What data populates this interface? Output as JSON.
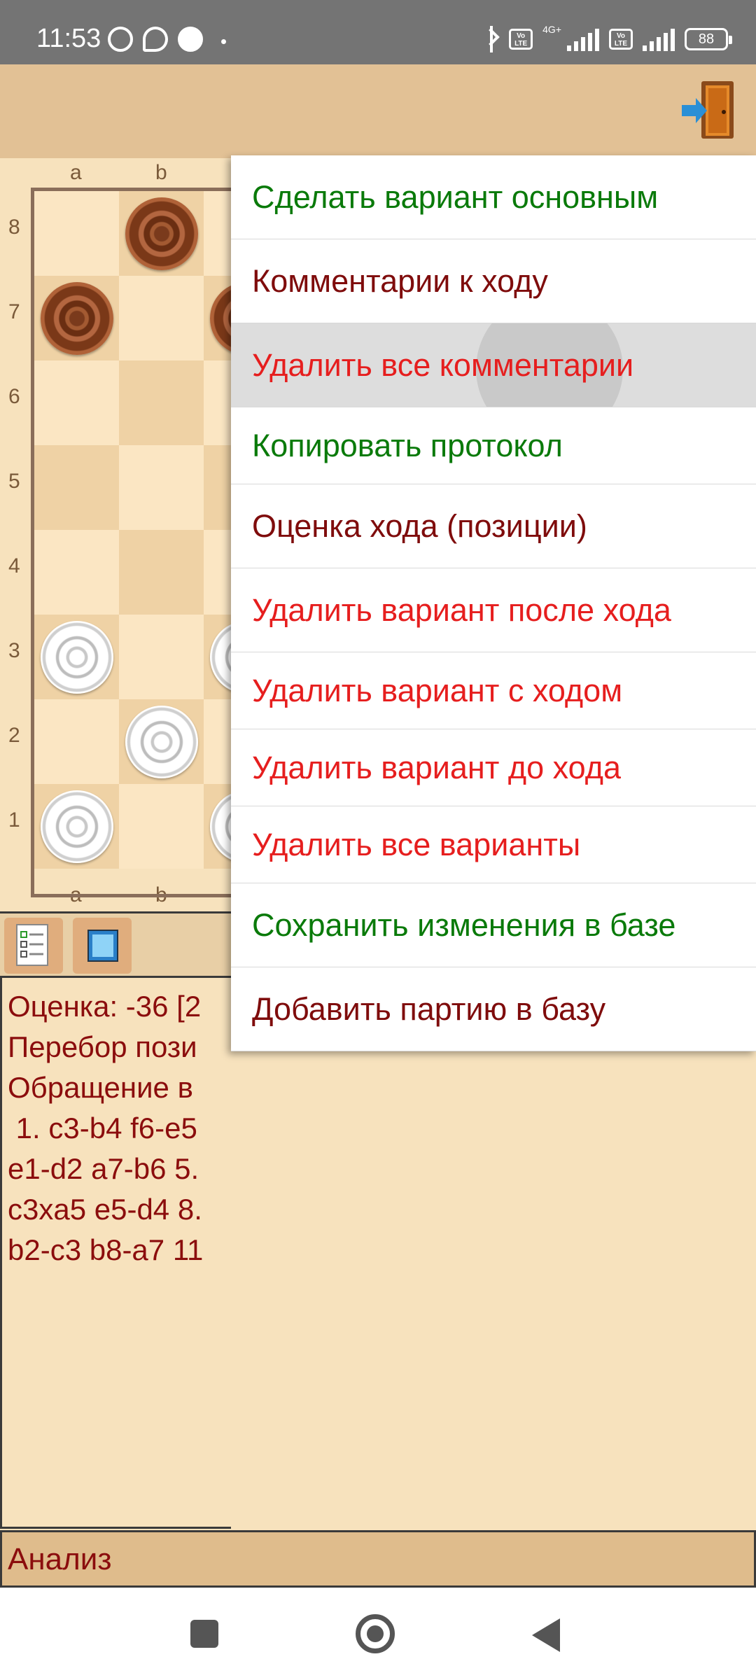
{
  "status_bar": {
    "time": "11:53",
    "network": "4G+",
    "volte": "Vo LTE",
    "battery": "88",
    "icons": [
      "viber-icon",
      "at-icon",
      "call-icon",
      "bluetooth-icon",
      "signal-icon",
      "battery-icon"
    ]
  },
  "toolbar": {
    "exit_icon": "exit-door-icon"
  },
  "board": {
    "files": [
      "a",
      "b"
    ],
    "ranks": [
      "8",
      "7",
      "6",
      "5",
      "4",
      "3",
      "2",
      "1"
    ],
    "pieces": [
      {
        "square": "b8",
        "color": "black"
      },
      {
        "square": "a7",
        "color": "black"
      },
      {
        "square": "c7",
        "color": "black"
      },
      {
        "square": "a3",
        "color": "white"
      },
      {
        "square": "c3",
        "color": "white"
      },
      {
        "square": "b2",
        "color": "white"
      },
      {
        "square": "a1",
        "color": "white"
      },
      {
        "square": "c1",
        "color": "white"
      }
    ]
  },
  "analysis": {
    "lines": [
      "Оценка: -36 [2",
      "Перебор пози",
      "Обращение в",
      " 1. c3-b4 f6-e5",
      "e1-d2 a7-b6 5.",
      "c3xa5 e5-d4 8.",
      "b2-c3 b8-a7 11"
    ],
    "tab_label": "Анализ"
  },
  "menu": {
    "items": [
      {
        "label": "Сделать вариант основным",
        "color": "#0a7a0a"
      },
      {
        "label": "Комментарии к ходу",
        "color": "#7f0c0c"
      },
      {
        "label": "Удалить все комментарии",
        "color": "#e61e1e"
      },
      {
        "label": "Копировать протокол",
        "color": "#0a7a0a"
      },
      {
        "label": "Оценка хода (позиции)",
        "color": "#7f0c0c"
      },
      {
        "label": "Удалить вариант после хода",
        "color": "#e61e1e"
      },
      {
        "label": "Удалить вариант с ходом",
        "color": "#e61e1e"
      },
      {
        "label": "Удалить вариант до хода",
        "color": "#e61e1e"
      },
      {
        "label": "Удалить все варианты",
        "color": "#e61e1e"
      },
      {
        "label": "Сохранить изменения в базе",
        "color": "#0a7a0a"
      },
      {
        "label": "Добавить партию в базу",
        "color": "#7f0c0c"
      }
    ]
  },
  "nav": {
    "icons": [
      "recents-icon",
      "home-icon",
      "back-icon"
    ]
  }
}
